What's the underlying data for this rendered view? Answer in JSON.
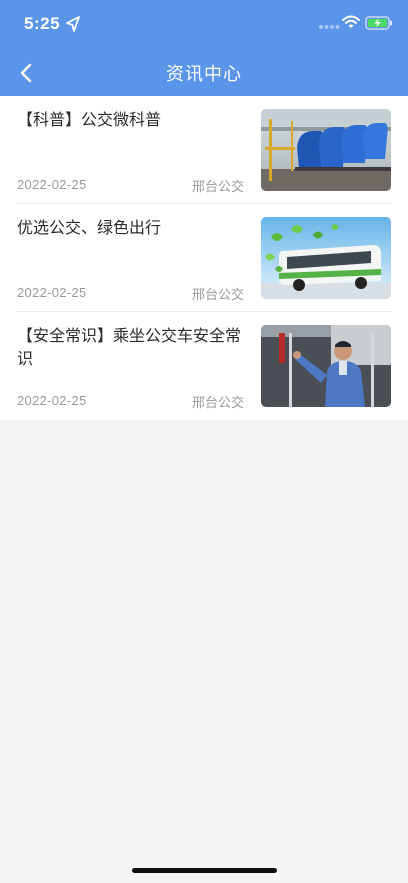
{
  "status_bar": {
    "time": "5:25"
  },
  "header": {
    "title": "资讯中心",
    "back_icon": "chevron-left-icon"
  },
  "news": [
    {
      "title": "【科普】公交微科普",
      "date": "2022-02-25",
      "source": "邢台公交",
      "thumbnail": "bus-seats-photo"
    },
    {
      "title": "优选公交、绿色出行",
      "date": "2022-02-25",
      "source": "邢台公交",
      "thumbnail": "green-bus-photo"
    },
    {
      "title": "【安全常识】乘坐公交车安全常识",
      "date": "2022-02-25",
      "source": "邢台公交",
      "thumbnail": "police-on-bus-photo"
    }
  ],
  "colors": {
    "header_bg": "#5b95ea",
    "page_bg": "#f5f5f5",
    "card_bg": "#ffffff",
    "meta_text": "#999999"
  }
}
